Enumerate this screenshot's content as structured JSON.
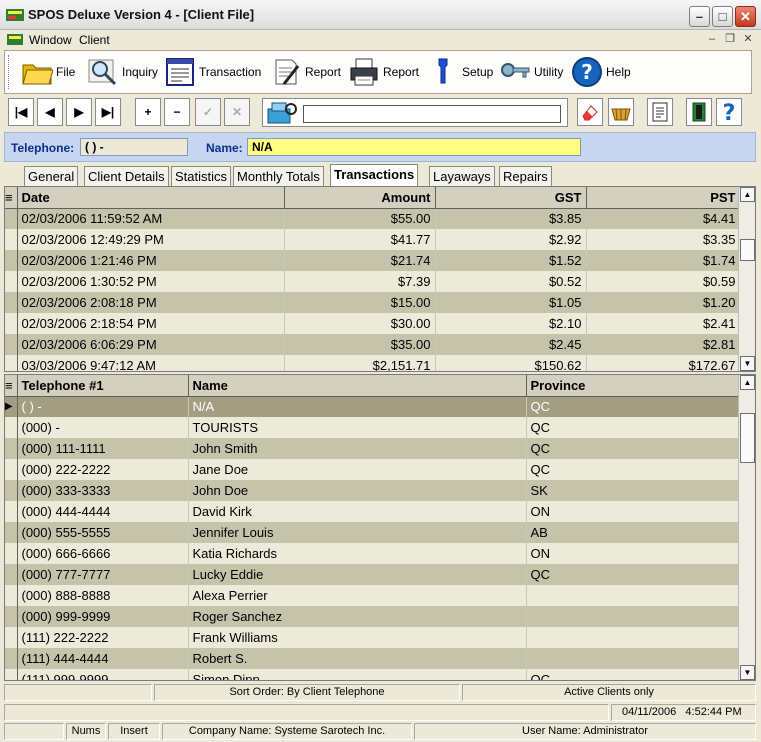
{
  "window": {
    "title": "SPOS Deluxe Version 4 - [Client File]",
    "minimize": "–",
    "maximize": "□",
    "close": "✕",
    "app_icon": "spos-app-icon"
  },
  "menu": {
    "items": [
      "Window",
      "Client"
    ]
  },
  "toolbar": {
    "items": [
      {
        "label": "File",
        "icon": "folder-icon"
      },
      {
        "label": "Inquiry",
        "icon": "magnifier-icon"
      },
      {
        "label": "Transaction",
        "icon": "transaction-icon"
      },
      {
        "label": "Report",
        "icon": "report-pen-icon"
      },
      {
        "label": "Report",
        "icon": "printer-icon"
      },
      {
        "label": "Setup",
        "icon": "wrench-icon"
      },
      {
        "label": "Utility",
        "icon": "keys-icon"
      },
      {
        "label": "Help",
        "icon": "help-icon"
      }
    ]
  },
  "nav": {
    "first": "|◀",
    "prev": "◀",
    "next": "▶",
    "last": "▶|",
    "add": "+",
    "remove": "−",
    "confirm": "✓",
    "cancel": "✕",
    "search_value": ""
  },
  "client": {
    "telephone_label": "Telephone:",
    "telephone_value": "(   )    -",
    "name_label": "Name:",
    "name_value": "N/A"
  },
  "tabs": [
    "General",
    "Client Details",
    "Statistics",
    "Monthly Totals",
    "Transactions",
    "Layaways",
    "Repairs"
  ],
  "active_tab": "Transactions",
  "transactions": {
    "columns": [
      "Date",
      "Amount",
      "GST",
      "PST"
    ],
    "rows": [
      [
        "02/03/2006 11:59:52 AM",
        "$55.00",
        "$3.85",
        "$4.41"
      ],
      [
        "02/03/2006 12:49:29 PM",
        "$41.77",
        "$2.92",
        "$3.35"
      ],
      [
        "02/03/2006 1:21:46 PM",
        "$21.74",
        "$1.52",
        "$1.74"
      ],
      [
        "02/03/2006 1:30:52 PM",
        "$7.39",
        "$0.52",
        "$0.59"
      ],
      [
        "02/03/2006 2:08:18 PM",
        "$15.00",
        "$1.05",
        "$1.20"
      ],
      [
        "02/03/2006 2:18:54 PM",
        "$30.00",
        "$2.10",
        "$2.41"
      ],
      [
        "02/03/2006 6:06:29 PM",
        "$35.00",
        "$2.45",
        "$2.81"
      ],
      [
        "03/03/2006 9:47:12 AM",
        "$2,151.71",
        "$150.62",
        "$172.67"
      ]
    ]
  },
  "clients": {
    "columns": [
      "Telephone #1",
      "Name",
      "Province"
    ],
    "rows": [
      [
        "(   )    -",
        "N/A",
        "QC"
      ],
      [
        "(000)    -",
        "TOURISTS",
        "QC"
      ],
      [
        "(000) 111-1111",
        "John Smith",
        "QC"
      ],
      [
        "(000) 222-2222",
        "Jane Doe",
        "QC"
      ],
      [
        "(000) 333-3333",
        "John Doe",
        "SK"
      ],
      [
        "(000) 444-4444",
        "David Kirk",
        "ON"
      ],
      [
        "(000) 555-5555",
        "Jennifer Louis",
        "AB"
      ],
      [
        "(000) 666-6666",
        "Katia Richards",
        "ON"
      ],
      [
        "(000) 777-7777",
        "Lucky Eddie",
        "QC"
      ],
      [
        "(000) 888-8888",
        "Alexa Perrier",
        ""
      ],
      [
        "(000) 999-9999",
        "Roger Sanchez",
        ""
      ],
      [
        "(111) 222-2222",
        "Frank Williams",
        ""
      ],
      [
        "(111) 444-4444",
        "Robert S.",
        ""
      ],
      [
        "(111) 999-9999",
        "Simon Dipp",
        "QC"
      ]
    ]
  },
  "status1": {
    "sort_order": "Sort Order: By Client Telephone",
    "filter": "Active Clients only"
  },
  "status2": {
    "date": "04/11/2006",
    "time": "4:52:44 PM"
  },
  "status3": {
    "nums": "Nums",
    "insert": "Insert",
    "company": "Company Name: Systeme Sarotech Inc.",
    "user": "User Name: Administrator"
  },
  "colors": {
    "header_bg": "#c6d6f0",
    "label_blue": "#0b2f8a",
    "name_field_bg": "#ffff80",
    "row_dark": "#c6c3ab",
    "row_light": "#ecead8"
  }
}
